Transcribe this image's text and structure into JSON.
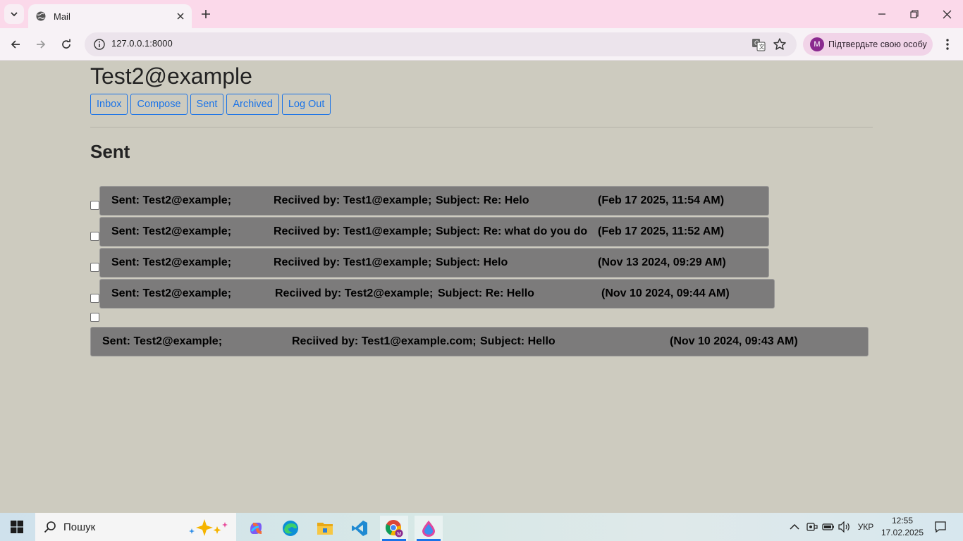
{
  "browser": {
    "tab_title": "Mail",
    "url": "127.0.0.1:8000",
    "profile_label": "Підтвердьте свою особу",
    "profile_initial": "M"
  },
  "page": {
    "user_title": "Test2@example",
    "nav": {
      "inbox": "Inbox",
      "compose": "Compose",
      "sent": "Sent",
      "archived": "Archived",
      "logout": "Log Out"
    },
    "section_title": "Sent"
  },
  "emails": [
    {
      "sender": "Sent: Test2@example;",
      "recipient": "Reciived by: Test1@example;",
      "subject": "Subject: Re: Helo",
      "timestamp": "(Feb 17 2025, 11:54 AM)",
      "checked": false
    },
    {
      "sender": "Sent: Test2@example;",
      "recipient": "Reciived by: Test1@example;",
      "subject": "Subject: Re: what do you do",
      "timestamp": "(Feb 17 2025, 11:52 AM)",
      "checked": false
    },
    {
      "sender": "Sent: Test2@example;",
      "recipient": "Reciived by: Test1@example;",
      "subject": "Subject: Helo",
      "timestamp": "(Nov 13 2024, 09:29 AM)",
      "checked": false
    },
    {
      "sender": "Sent: Test2@example;",
      "recipient": "Reciived by: Test2@example;",
      "subject": "Subject: Re: Hello",
      "timestamp": "(Nov 10 2024, 09:44 AM)",
      "checked": false
    },
    {
      "sender": "Sent: Test2@example;",
      "recipient": "Reciived by: Test1@example.com;",
      "subject": "Subject: Hello",
      "timestamp": "(Nov 10 2024, 09:43 AM)",
      "checked": false
    }
  ],
  "taskbar": {
    "search_placeholder": "Пошук",
    "language": "УКР",
    "time": "12:55",
    "date": "17.02.2025",
    "apps": [
      "copilot-icon",
      "edge-icon",
      "file-explorer-icon",
      "vscode-icon",
      "chrome-icon",
      "paint-icon"
    ]
  },
  "colors": {
    "page_background": "#cdcbbf",
    "email_row_background": "#7c7b7b",
    "nav_button_accent": "#1a73e8",
    "tabbar_background": "#fbd9ea"
  }
}
